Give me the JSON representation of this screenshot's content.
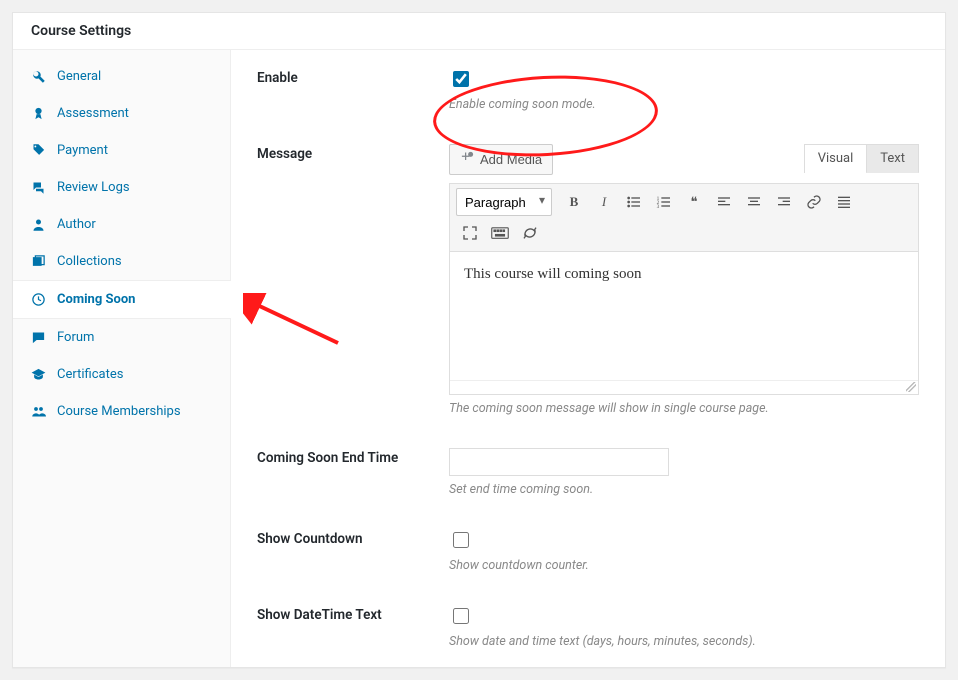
{
  "panelTitle": "Course Settings",
  "sidebar": {
    "items": [
      {
        "label": "General",
        "icon": "wrench"
      },
      {
        "label": "Assessment",
        "icon": "ribbon"
      },
      {
        "label": "Payment",
        "icon": "tag"
      },
      {
        "label": "Review Logs",
        "icon": "comments"
      },
      {
        "label": "Author",
        "icon": "user"
      },
      {
        "label": "Collections",
        "icon": "collection"
      },
      {
        "label": "Coming Soon",
        "icon": "clock"
      },
      {
        "label": "Forum",
        "icon": "forum"
      },
      {
        "label": "Certificates",
        "icon": "cap"
      },
      {
        "label": "Course Memberships",
        "icon": "group"
      }
    ],
    "activeIndex": 6
  },
  "fields": {
    "enable": {
      "label": "Enable",
      "checked": true,
      "help": "Enable coming soon mode."
    },
    "message": {
      "label": "Message",
      "addMediaLabel": "Add Media",
      "tabs": {
        "visual": "Visual",
        "text": "Text",
        "active": "text"
      },
      "formatSelected": "Paragraph",
      "content": "This course will coming soon",
      "help": "The coming soon message will show in single course page."
    },
    "endTime": {
      "label": "Coming Soon End Time",
      "value": "",
      "help": "Set end time coming soon."
    },
    "showCountdown": {
      "label": "Show Countdown",
      "checked": false,
      "help": "Show countdown counter."
    },
    "showDateTimeText": {
      "label": "Show DateTime Text",
      "checked": false,
      "help": "Show date and time text (days, hours, minutes, seconds)."
    }
  }
}
